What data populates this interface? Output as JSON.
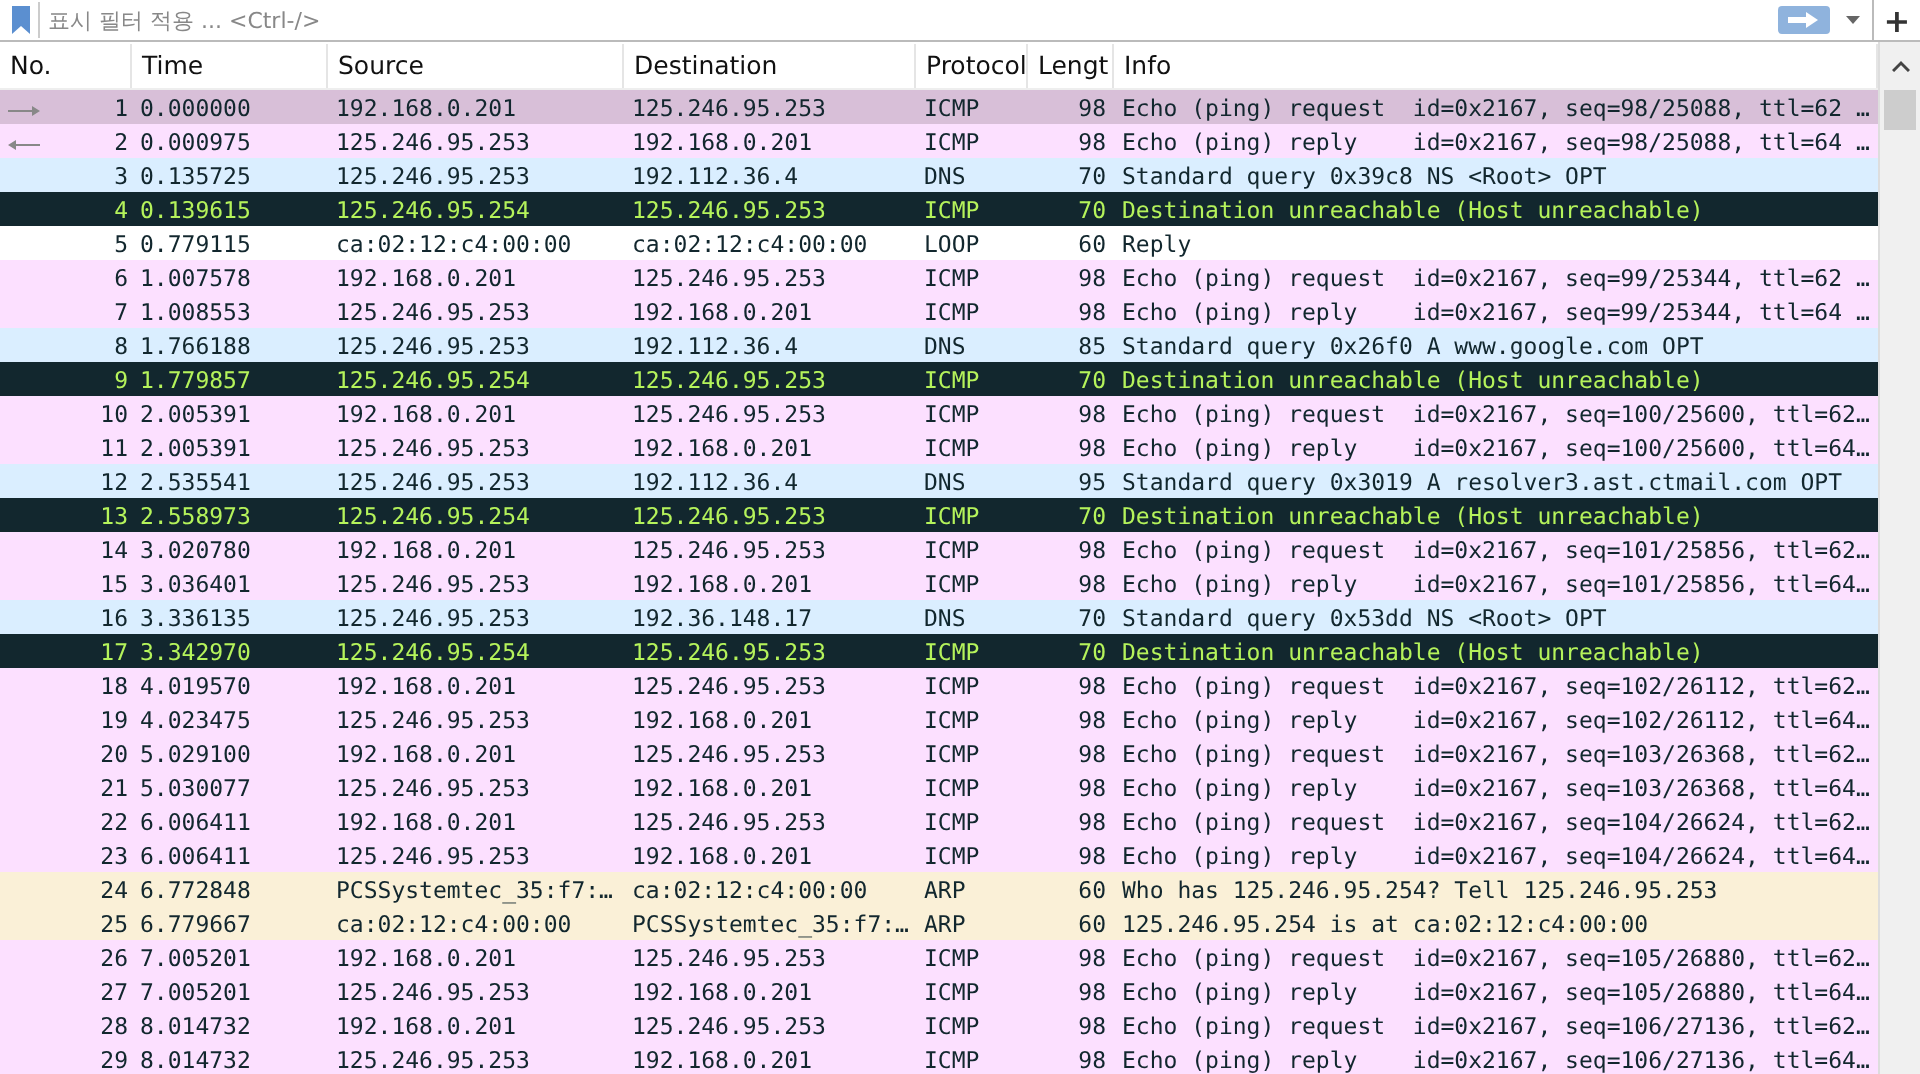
{
  "filter": {
    "placeholder": "표시 필터 적용 ... <Ctrl-/>",
    "add_label": "+"
  },
  "columns": [
    {
      "label": "No."
    },
    {
      "label": "Time"
    },
    {
      "label": "Source"
    },
    {
      "label": "Destination"
    },
    {
      "label": "Protocol"
    },
    {
      "label": "Lengt"
    },
    {
      "label": "Info"
    }
  ],
  "rows": [
    {
      "no": "1",
      "time": "0.000000",
      "source": "192.168.0.201",
      "destination": "125.246.95.253",
      "protocol": "ICMP",
      "length": "98",
      "info": "Echo (ping) request  id=0x2167, seq=98/25088, ttl=62 …",
      "kind": "icmp",
      "selected": true,
      "related": {
        "kind": "request"
      }
    },
    {
      "no": "2",
      "time": "0.000975",
      "source": "125.246.95.253",
      "destination": "192.168.0.201",
      "protocol": "ICMP",
      "length": "98",
      "info": "Echo (ping) reply    id=0x2167, seq=98/25088, ttl=64 …",
      "kind": "icmp",
      "selected": false,
      "related": {
        "kind": "reply"
      }
    },
    {
      "no": "3",
      "time": "0.135725",
      "source": "125.246.95.253",
      "destination": "192.112.36.4",
      "protocol": "DNS",
      "length": "70",
      "info": "Standard query 0x39c8 NS <Root> OPT",
      "kind": "dns",
      "selected": false
    },
    {
      "no": "4",
      "time": "0.139615",
      "source": "125.246.95.254",
      "destination": "125.246.95.253",
      "protocol": "ICMP",
      "length": "70",
      "info": "Destination unreachable (Host unreachable)",
      "kind": "error",
      "selected": false
    },
    {
      "no": "5",
      "time": "0.779115",
      "source": "ca:02:12:c4:00:00",
      "destination": "ca:02:12:c4:00:00",
      "protocol": "LOOP",
      "length": "60",
      "info": "Reply",
      "kind": "loop",
      "selected": false
    },
    {
      "no": "6",
      "time": "1.007578",
      "source": "192.168.0.201",
      "destination": "125.246.95.253",
      "protocol": "ICMP",
      "length": "98",
      "info": "Echo (ping) request  id=0x2167, seq=99/25344, ttl=62 …",
      "kind": "icmp",
      "selected": false
    },
    {
      "no": "7",
      "time": "1.008553",
      "source": "125.246.95.253",
      "destination": "192.168.0.201",
      "protocol": "ICMP",
      "length": "98",
      "info": "Echo (ping) reply    id=0x2167, seq=99/25344, ttl=64 …",
      "kind": "icmp",
      "selected": false
    },
    {
      "no": "8",
      "time": "1.766188",
      "source": "125.246.95.253",
      "destination": "192.112.36.4",
      "protocol": "DNS",
      "length": "85",
      "info": "Standard query 0x26f0 A www.google.com OPT",
      "kind": "dns",
      "selected": false
    },
    {
      "no": "9",
      "time": "1.779857",
      "source": "125.246.95.254",
      "destination": "125.246.95.253",
      "protocol": "ICMP",
      "length": "70",
      "info": "Destination unreachable (Host unreachable)",
      "kind": "error",
      "selected": false
    },
    {
      "no": "10",
      "time": "2.005391",
      "source": "192.168.0.201",
      "destination": "125.246.95.253",
      "protocol": "ICMP",
      "length": "98",
      "info": "Echo (ping) request  id=0x2167, seq=100/25600, ttl=62…",
      "kind": "icmp",
      "selected": false
    },
    {
      "no": "11",
      "time": "2.005391",
      "source": "125.246.95.253",
      "destination": "192.168.0.201",
      "protocol": "ICMP",
      "length": "98",
      "info": "Echo (ping) reply    id=0x2167, seq=100/25600, ttl=64…",
      "kind": "icmp",
      "selected": false
    },
    {
      "no": "12",
      "time": "2.535541",
      "source": "125.246.95.253",
      "destination": "192.112.36.4",
      "protocol": "DNS",
      "length": "95",
      "info": "Standard query 0x3019 A resolver3.ast.ctmail.com OPT",
      "kind": "dns",
      "selected": false
    },
    {
      "no": "13",
      "time": "2.558973",
      "source": "125.246.95.254",
      "destination": "125.246.95.253",
      "protocol": "ICMP",
      "length": "70",
      "info": "Destination unreachable (Host unreachable)",
      "kind": "error",
      "selected": false
    },
    {
      "no": "14",
      "time": "3.020780",
      "source": "192.168.0.201",
      "destination": "125.246.95.253",
      "protocol": "ICMP",
      "length": "98",
      "info": "Echo (ping) request  id=0x2167, seq=101/25856, ttl=62…",
      "kind": "icmp",
      "selected": false
    },
    {
      "no": "15",
      "time": "3.036401",
      "source": "125.246.95.253",
      "destination": "192.168.0.201",
      "protocol": "ICMP",
      "length": "98",
      "info": "Echo (ping) reply    id=0x2167, seq=101/25856, ttl=64…",
      "kind": "icmp",
      "selected": false
    },
    {
      "no": "16",
      "time": "3.336135",
      "source": "125.246.95.253",
      "destination": "192.36.148.17",
      "protocol": "DNS",
      "length": "70",
      "info": "Standard query 0x53dd NS <Root> OPT",
      "kind": "dns",
      "selected": false
    },
    {
      "no": "17",
      "time": "3.342970",
      "source": "125.246.95.254",
      "destination": "125.246.95.253",
      "protocol": "ICMP",
      "length": "70",
      "info": "Destination unreachable (Host unreachable)",
      "kind": "error",
      "selected": false
    },
    {
      "no": "18",
      "time": "4.019570",
      "source": "192.168.0.201",
      "destination": "125.246.95.253",
      "protocol": "ICMP",
      "length": "98",
      "info": "Echo (ping) request  id=0x2167, seq=102/26112, ttl=62…",
      "kind": "icmp",
      "selected": false
    },
    {
      "no": "19",
      "time": "4.023475",
      "source": "125.246.95.253",
      "destination": "192.168.0.201",
      "protocol": "ICMP",
      "length": "98",
      "info": "Echo (ping) reply    id=0x2167, seq=102/26112, ttl=64…",
      "kind": "icmp",
      "selected": false
    },
    {
      "no": "20",
      "time": "5.029100",
      "source": "192.168.0.201",
      "destination": "125.246.95.253",
      "protocol": "ICMP",
      "length": "98",
      "info": "Echo (ping) request  id=0x2167, seq=103/26368, ttl=62…",
      "kind": "icmp",
      "selected": false
    },
    {
      "no": "21",
      "time": "5.030077",
      "source": "125.246.95.253",
      "destination": "192.168.0.201",
      "protocol": "ICMP",
      "length": "98",
      "info": "Echo (ping) reply    id=0x2167, seq=103/26368, ttl=64…",
      "kind": "icmp",
      "selected": false
    },
    {
      "no": "22",
      "time": "6.006411",
      "source": "192.168.0.201",
      "destination": "125.246.95.253",
      "protocol": "ICMP",
      "length": "98",
      "info": "Echo (ping) request  id=0x2167, seq=104/26624, ttl=62…",
      "kind": "icmp",
      "selected": false
    },
    {
      "no": "23",
      "time": "6.006411",
      "source": "125.246.95.253",
      "destination": "192.168.0.201",
      "protocol": "ICMP",
      "length": "98",
      "info": "Echo (ping) reply    id=0x2167, seq=104/26624, ttl=64…",
      "kind": "icmp",
      "selected": false
    },
    {
      "no": "24",
      "time": "6.772848",
      "source": "PCSSystemtec_35:f7:…",
      "destination": "ca:02:12:c4:00:00",
      "protocol": "ARP",
      "length": "60",
      "info": "Who has 125.246.95.254? Tell 125.246.95.253",
      "kind": "arp",
      "selected": false
    },
    {
      "no": "25",
      "time": "6.779667",
      "source": "ca:02:12:c4:00:00",
      "destination": "PCSSystemtec_35:f7:…",
      "protocol": "ARP",
      "length": "60",
      "info": "125.246.95.254 is at ca:02:12:c4:00:00",
      "kind": "arp",
      "selected": false
    },
    {
      "no": "26",
      "time": "7.005201",
      "source": "192.168.0.201",
      "destination": "125.246.95.253",
      "protocol": "ICMP",
      "length": "98",
      "info": "Echo (ping) request  id=0x2167, seq=105/26880, ttl=62…",
      "kind": "icmp",
      "selected": false
    },
    {
      "no": "27",
      "time": "7.005201",
      "source": "125.246.95.253",
      "destination": "192.168.0.201",
      "protocol": "ICMP",
      "length": "98",
      "info": "Echo (ping) reply    id=0x2167, seq=105/26880, ttl=64…",
      "kind": "icmp",
      "selected": false
    },
    {
      "no": "28",
      "time": "8.014732",
      "source": "192.168.0.201",
      "destination": "125.246.95.253",
      "protocol": "ICMP",
      "length": "98",
      "info": "Echo (ping) request  id=0x2167, seq=106/27136, ttl=62…",
      "kind": "icmp",
      "selected": false
    },
    {
      "no": "29",
      "time": "8.014732",
      "source": "125.246.95.253",
      "destination": "192.168.0.201",
      "protocol": "ICMP",
      "length": "98",
      "info": "Echo (ping) reply    id=0x2167, seq=106/27136, ttl=64…",
      "kind": "icmp",
      "selected": false
    }
  ]
}
